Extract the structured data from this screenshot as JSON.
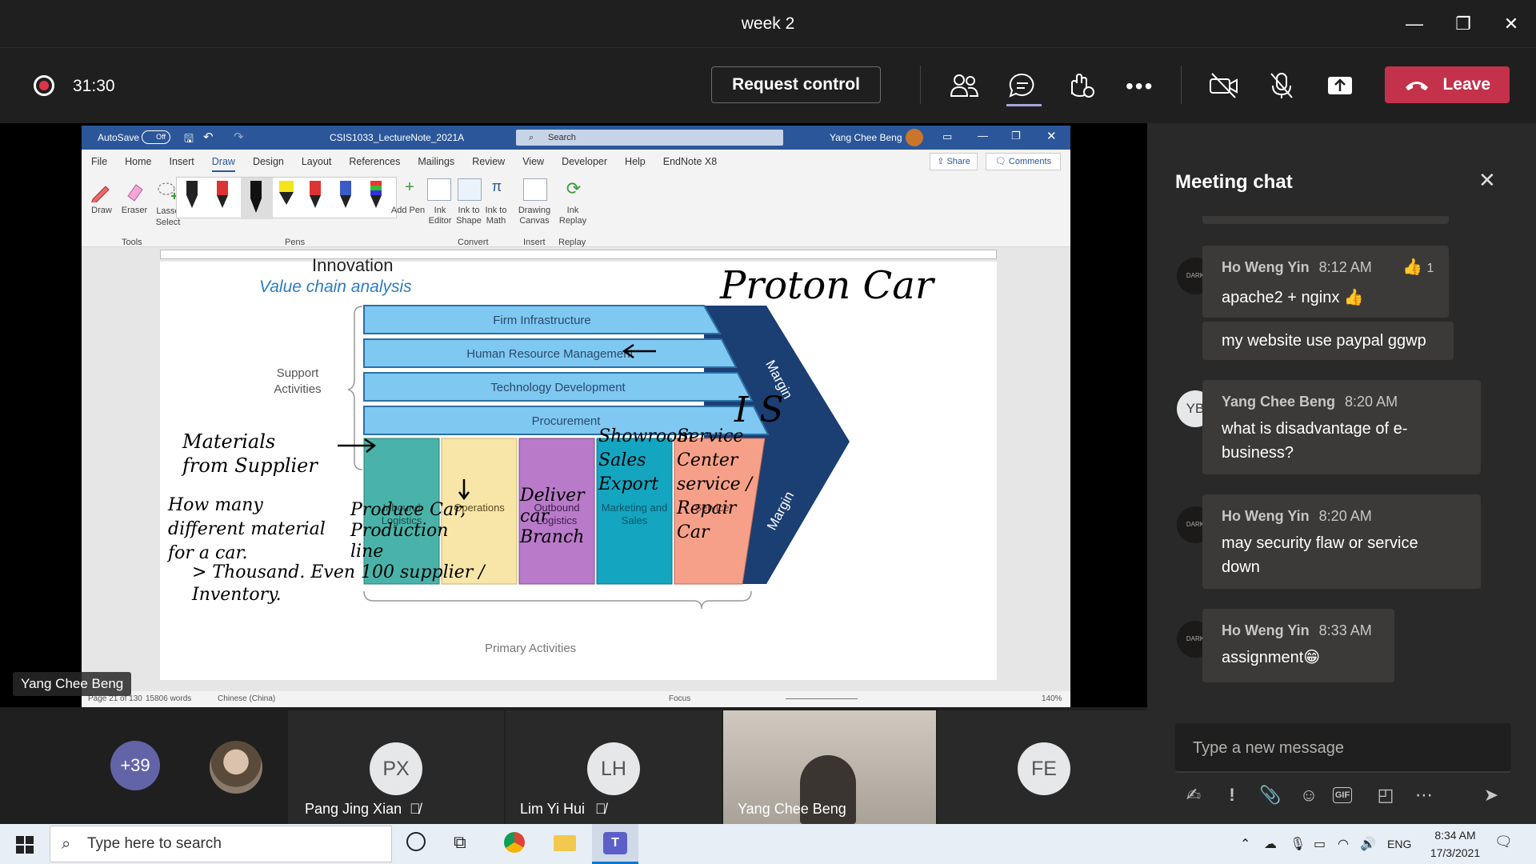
{
  "window": {
    "title": "week 2"
  },
  "toolbar": {
    "timer": "31:30",
    "request_control": "Request control",
    "leave": "Leave"
  },
  "word": {
    "autosave": "AutoSave",
    "autosave_state": "Off",
    "doc_name": "CSIS1033_LectureNote_2021A",
    "search": "Search",
    "user": "Yang Chee Beng",
    "tabs": [
      "File",
      "Home",
      "Insert",
      "Draw",
      "Design",
      "Layout",
      "References",
      "Mailings",
      "Review",
      "View",
      "Developer",
      "Help",
      "EndNote X8"
    ],
    "share": "Share",
    "comments": "Comments",
    "tools": [
      "Draw",
      "Eraser",
      "Lasso Select"
    ],
    "groups": [
      "Tools",
      "Pens",
      "Convert",
      "Insert",
      "Replay"
    ],
    "convert_tools": [
      "Add Pen",
      "Ink Editor",
      "Ink to Shape",
      "Ink to Math",
      "Drawing Canvas",
      "Ink Replay"
    ],
    "status": {
      "page": "Page 21 of 130",
      "words": "15806 words",
      "lang": "Chinese (China)",
      "focus": "Focus",
      "zoom": "140%"
    }
  },
  "slide": {
    "partial_bullet": "Innovation",
    "heading": "Value chain analysis",
    "support_label": "Support Activities",
    "support_rows": [
      "Firm Infrastructure",
      "Human Resource Management",
      "Technology Development",
      "Procurement"
    ],
    "primary_cols": [
      "Inbound Logistics",
      "Operations",
      "Outbound Logistics",
      "Marketing and Sales",
      "Service"
    ],
    "margin": "Margin",
    "primary_label": "Primary Activities",
    "ink": {
      "proton": "Proton Car",
      "is": "I S",
      "materials": "Materials from Supplier",
      "how_many": "How many different material for a car.",
      "thousand": "> Thousand. Even 100 supplier / Inventory.",
      "produce": "Produce Car, Production line",
      "deliver": "Deliver car Branch",
      "showroom": "Showroom Sales Export",
      "service": "Service Center service / Repair Car"
    }
  },
  "presenter_label": "Yang Chee Beng",
  "chat": {
    "title": "Meeting chat",
    "messages": [
      {
        "initials": "",
        "name": "Ho Weng Yin",
        "time": "8:12 AM",
        "lines": [
          "apache2 + nginx 👍"
        ],
        "reaction": "👍",
        "reaction_count": "1"
      },
      {
        "initials": "",
        "name": "",
        "time": "",
        "lines": [
          "my website use paypal ggwp"
        ]
      },
      {
        "initials": "YB",
        "name": "Yang Chee Beng",
        "time": "8:20 AM",
        "lines": [
          "what is disadvantage of e-",
          "business?"
        ]
      },
      {
        "initials": "",
        "name": "Ho Weng Yin",
        "time": "8:20 AM",
        "lines": [
          "may security flaw or service",
          "down"
        ]
      },
      {
        "initials": "",
        "name": "Ho Weng Yin",
        "time": "8:33 AM",
        "lines": [
          "assignment😁"
        ]
      }
    ],
    "compose_placeholder": "Type a new message"
  },
  "participants": {
    "overflow": "+39",
    "tiles": [
      {
        "initials": "PX",
        "name": "Pang Jing Xian"
      },
      {
        "initials": "LH",
        "name": "Lim Yi Hui"
      },
      {
        "initials": "",
        "name": "Yang Chee Beng"
      },
      {
        "initials": "FE",
        "name": ""
      }
    ]
  },
  "taskbar": {
    "search_placeholder": "Type here to search",
    "lang": "ENG",
    "time": "8:34 AM",
    "date": "17/3/2021"
  }
}
